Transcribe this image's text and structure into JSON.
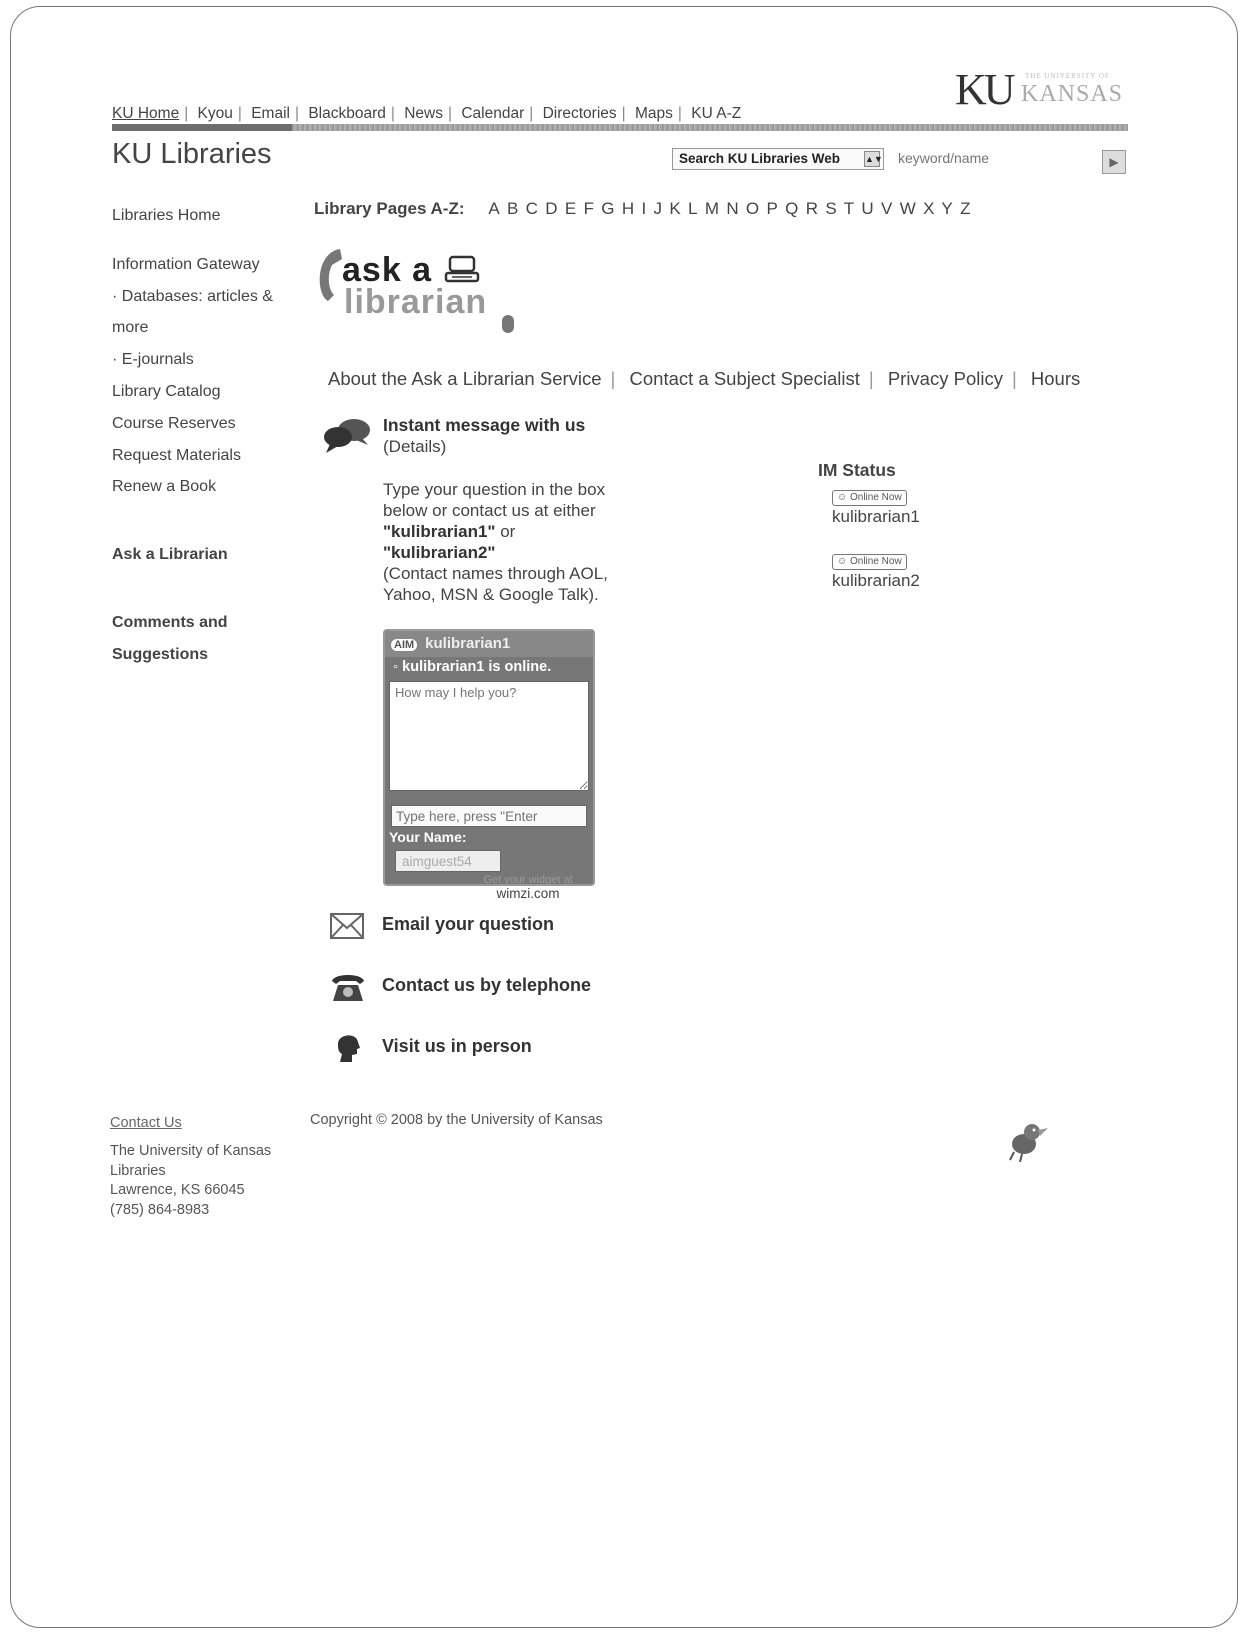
{
  "top_nav": {
    "links": [
      "KU Home",
      "Kyou",
      "Email",
      "Blackboard",
      "News",
      "Calendar",
      "Directories",
      "Maps",
      "KU A-Z"
    ]
  },
  "logo": {
    "ku": "KU",
    "kansas": "KANSAS",
    "university": "THE UNIVERSITY OF"
  },
  "site_title": "KU Libraries",
  "search": {
    "scope": "Search KU Libraries Web",
    "placeholder": "keyword/name"
  },
  "sidebar": {
    "home": "Libraries Home",
    "items": [
      "Information Gateway",
      "· Databases: articles &",
      "more",
      "· E-journals",
      "Library Catalog",
      "Course Reserves",
      "Request Materials",
      "Renew a Book"
    ],
    "ask": "Ask a Librarian",
    "comments_1": "Comments and",
    "comments_2": "Suggestions"
  },
  "az": {
    "label": "Library Pages A-Z:",
    "letters": [
      "A",
      "B",
      "C",
      "D",
      "E",
      "F",
      "G",
      "H",
      "I",
      "J",
      "K",
      "L",
      "M",
      "N",
      "O",
      "P",
      "Q",
      "R",
      "S",
      "T",
      "U",
      "V",
      "W",
      "X",
      "Y",
      "Z"
    ]
  },
  "ask_logo": {
    "line1": "ask a",
    "line2": "librarian"
  },
  "sub_nav": [
    "About the Ask a Librarian Service",
    "Contact a Subject Specialist",
    "Privacy Policy",
    "Hours"
  ],
  "im": {
    "title": "Instant message with us",
    "details": "(Details)",
    "desc_line1": "Type your question in the box",
    "desc_line2": "below or contact us at either",
    "desc_name1": "\"kulibrarian1\"",
    "desc_or": " or",
    "desc_name2": "\"kulibrarian2\"",
    "desc_line5": "(Contact names through AOL,",
    "desc_line6": "Yahoo, MSN & Google Talk)."
  },
  "im_status": {
    "title": "IM Status",
    "accounts": [
      {
        "badge": "Online Now",
        "name": "kulibrarian1"
      },
      {
        "badge": "Online Now",
        "name": "kulibrarian2"
      }
    ]
  },
  "chat": {
    "aim": "AIM",
    "title": "kulibrarian1",
    "online": "kulibrarian1 is online.",
    "message_placeholder": "How may I help you?",
    "type_placeholder": "Type here, press \"Enter",
    "name_label": "Your Name:",
    "name_value": "aimguest54",
    "promo_partial": "Get your widget at",
    "promo_site": "wimzi.com"
  },
  "methods": {
    "email": "Email your question",
    "phone": "Contact us by telephone",
    "visit": "Visit us in person"
  },
  "footer": {
    "contact": "Contact Us",
    "address_1": "The University of Kansas",
    "address_2": "Libraries",
    "address_3": "Lawrence, KS 66045",
    "address_4": "(785) 864-8983",
    "copyright": "Copyright © 2008 by the University of Kansas"
  }
}
